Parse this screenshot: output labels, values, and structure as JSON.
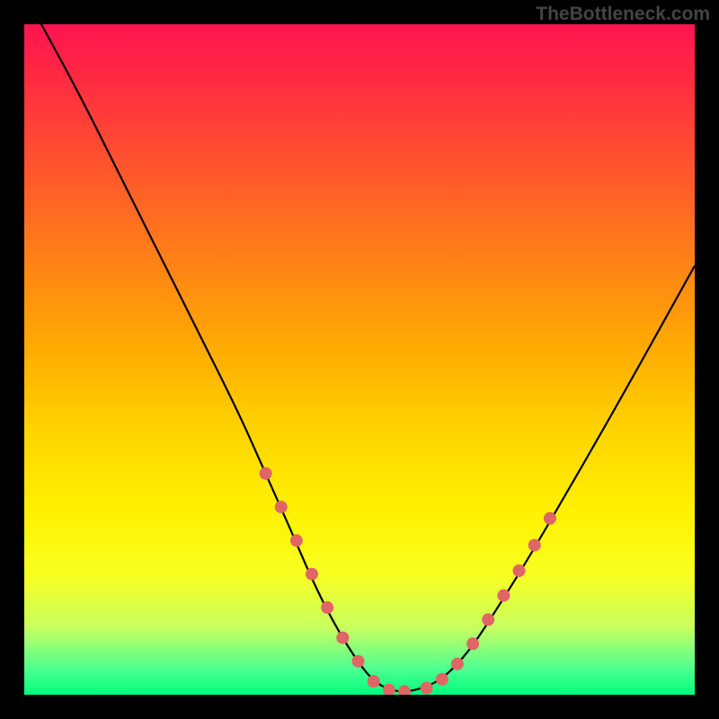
{
  "watermark": "TheBottleneck.com",
  "chart_data": {
    "type": "line",
    "title": "",
    "xlabel": "",
    "ylabel": "",
    "xlim": [
      0,
      100
    ],
    "ylim": [
      0,
      100
    ],
    "grid": false,
    "legend": false,
    "series": [
      {
        "name": "curve",
        "x": [
          2,
          8,
          14,
          20,
          26,
          32,
          36,
          40,
          43,
          46,
          49,
          52,
          55,
          58,
          62,
          66,
          70,
          75,
          82,
          90,
          100
        ],
        "y": [
          101,
          90,
          78,
          66,
          54,
          42,
          33,
          24,
          17,
          11,
          6,
          2,
          0.5,
          0.5,
          2,
          6,
          12,
          20,
          32,
          46,
          64
        ]
      }
    ],
    "markers": {
      "left_segment": {
        "x": [
          36,
          38.3,
          40.6,
          42.9,
          45.2,
          47.5,
          49.8,
          52.1,
          54.4,
          56.7
        ],
        "y": [
          33,
          28,
          23,
          18,
          13,
          8.5,
          5,
          2,
          0.7,
          0.5
        ]
      },
      "right_segment": {
        "x": [
          60,
          62.3,
          64.6,
          66.9,
          69.2,
          71.5,
          73.8,
          76.1,
          78.4
        ],
        "y": [
          1,
          2.3,
          4.6,
          7.6,
          11.2,
          14.8,
          18.5,
          22.3,
          26.3
        ]
      },
      "color": "#e06666",
      "radius": 7
    },
    "background": "rainbow-vertical-gradient"
  }
}
